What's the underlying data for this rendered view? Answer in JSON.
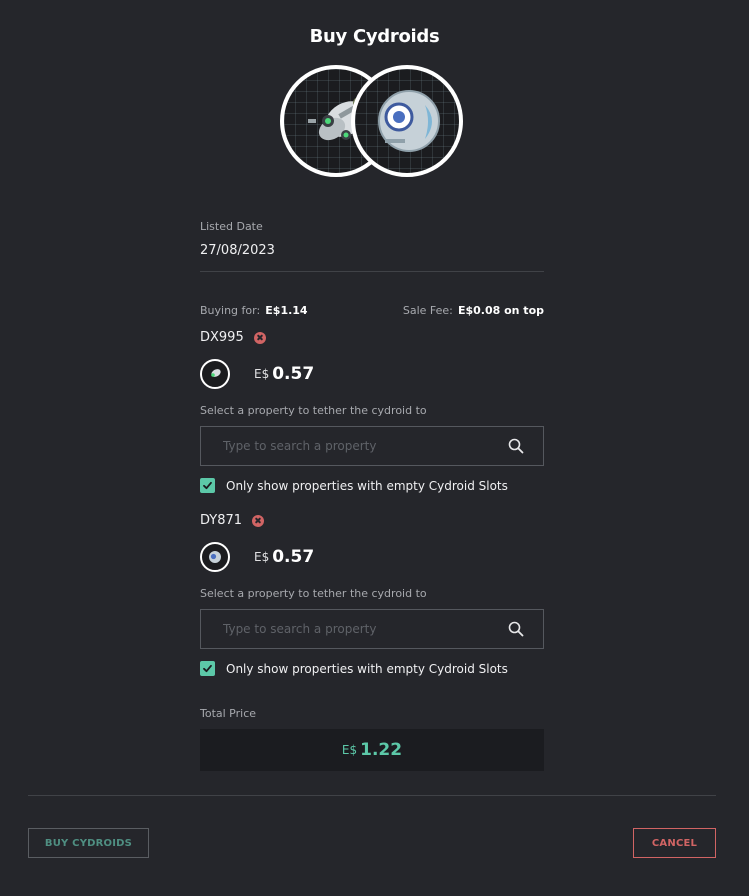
{
  "modal": {
    "title": "Buy Cydroids"
  },
  "listing": {
    "listed_date_label": "Listed Date",
    "listed_date_value": "27/08/2023"
  },
  "fees": {
    "buying_for_label": "Buying for:",
    "buying_for_value": "E$1.14",
    "sale_fee_label": "Sale Fee:",
    "sale_fee_value": "E$0.08 on top"
  },
  "cydroids": [
    {
      "name": "DX995",
      "currency": "E$",
      "price": "0.57",
      "select_label": "Select a property to tether the cydroid to",
      "search_placeholder": "Type to search a property",
      "filter_label": "Only show properties with empty Cydroid Slots",
      "filter_checked": true
    },
    {
      "name": "DY871",
      "currency": "E$",
      "price": "0.57",
      "select_label": "Select a property to tether the cydroid to",
      "search_placeholder": "Type to search a property",
      "filter_label": "Only show properties with empty Cydroid Slots",
      "filter_checked": true
    }
  ],
  "total": {
    "label": "Total Price",
    "currency": "E$",
    "amount": "1.22"
  },
  "buttons": {
    "buy": "BUY CYDROIDS",
    "cancel": "CANCEL"
  },
  "colors": {
    "background": "#25262b",
    "accent": "#5cc8a8",
    "danger": "#d16464",
    "panel": "#1b1c20"
  }
}
